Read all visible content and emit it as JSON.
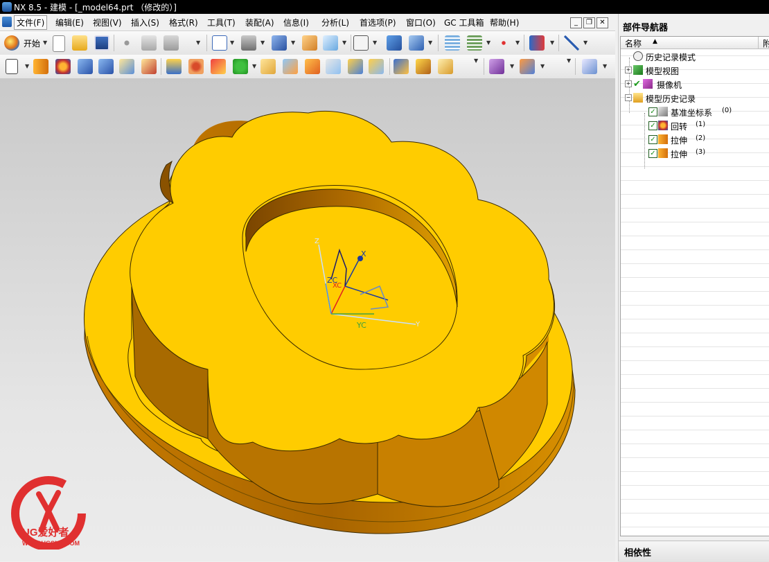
{
  "window": {
    "title": "NX 8.5 - 建模 - [_model64.prt （修改的）]"
  },
  "menubar": {
    "items": [
      "文件(F)",
      "编辑(E)",
      "视图(V)",
      "插入(S)",
      "格式(R)",
      "工具(T)",
      "装配(A)",
      "信息(I)",
      "分析(L)",
      "首选项(P)",
      "窗口(O)",
      "GC 工具箱",
      "帮助(H)"
    ]
  },
  "toolbar": {
    "start_label": "开始"
  },
  "viewport": {
    "axis_labels": {
      "x": "X",
      "zc": "ZC",
      "xc": "XC",
      "yc": "YC",
      "y": "Y",
      "z": "Z"
    },
    "watermark_text": "UG爱好者",
    "watermark_url": "WWW.UGSNX.COM"
  },
  "navigator": {
    "title": "部件导航器",
    "column_name": "名称",
    "column_second": "附",
    "items": [
      {
        "label": "历史记录模式",
        "num": ""
      },
      {
        "label": "模型视图",
        "num": ""
      },
      {
        "label": "摄像机",
        "num": ""
      },
      {
        "label": "模型历史记录",
        "num": ""
      },
      {
        "label": "基准坐标系",
        "num": "(0)"
      },
      {
        "label": "回转",
        "num": "(1)"
      },
      {
        "label": "拉伸",
        "num": "(2)"
      },
      {
        "label": "拉伸",
        "num": "(3)"
      }
    ],
    "dependency_title": "相依性"
  },
  "colors": {
    "model_top": "#ffcc00",
    "model_wall": "#c07800",
    "model_edge": "#3a2a00"
  }
}
